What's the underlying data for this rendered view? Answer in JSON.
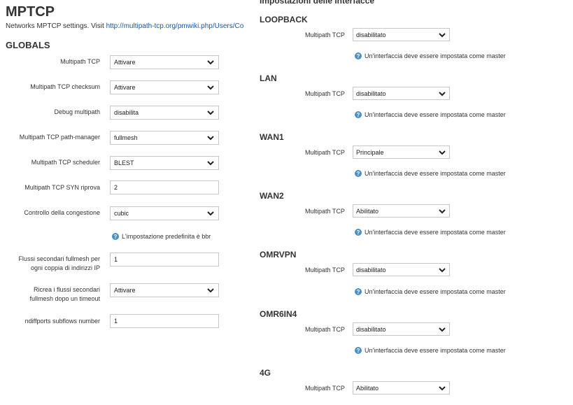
{
  "page": {
    "title": "MPTCP",
    "desc_prefix": "Networks MPTCP settings. Visit ",
    "desc_link": "http://multipath-tcp.org/pmwiki.php/Users/Cor",
    "globals_title": "GLOBALS",
    "interfaces_title": "Impostazioni delle interfacce"
  },
  "globals": {
    "multipath_tcp": {
      "label": "Multipath TCP",
      "value": "Attivare"
    },
    "checksum": {
      "label": "Multipath TCP checksum",
      "value": "Attivare"
    },
    "debug": {
      "label": "Debug multipath",
      "value": "disabilita"
    },
    "path_manager": {
      "label": "Multipath TCP path-manager",
      "value": "fullmesh"
    },
    "scheduler": {
      "label": "Multipath TCP scheduler",
      "value": "BLEST"
    },
    "syn_retries": {
      "label": "Multipath TCP SYN riprova",
      "value": "2"
    },
    "congestion": {
      "label": "Controllo della congestione",
      "value": "cubic",
      "hint": "L'impostazione predefinita è bbr"
    },
    "subflows_line1": "Flussi secondari fullmesh per",
    "subflows_line2": "ogni coppia di indirizzi IP",
    "subflows_value": "1",
    "recreate_line1": "Ricrea i flussi secondari",
    "recreate_line2": "fullmesh dopo un timeout",
    "recreate_value": "Attivare",
    "ndiffports": {
      "label": "ndiffports subflows number",
      "value": "1"
    }
  },
  "interfaces": {
    "field_label": "Multipath TCP",
    "hint": "Un'interfaccia deve essere impostata come master",
    "items": [
      {
        "name": "LOOPBACK",
        "value": "disabilitato"
      },
      {
        "name": "LAN",
        "value": "disabilitato"
      },
      {
        "name": "WAN1",
        "value": "Principale"
      },
      {
        "name": "WAN2",
        "value": "Abilitato"
      },
      {
        "name": "OMRVPN",
        "value": "disabilitato"
      },
      {
        "name": "OMR6IN4",
        "value": "disabilitato"
      },
      {
        "name": "4G",
        "value": "Abilitato"
      }
    ]
  }
}
